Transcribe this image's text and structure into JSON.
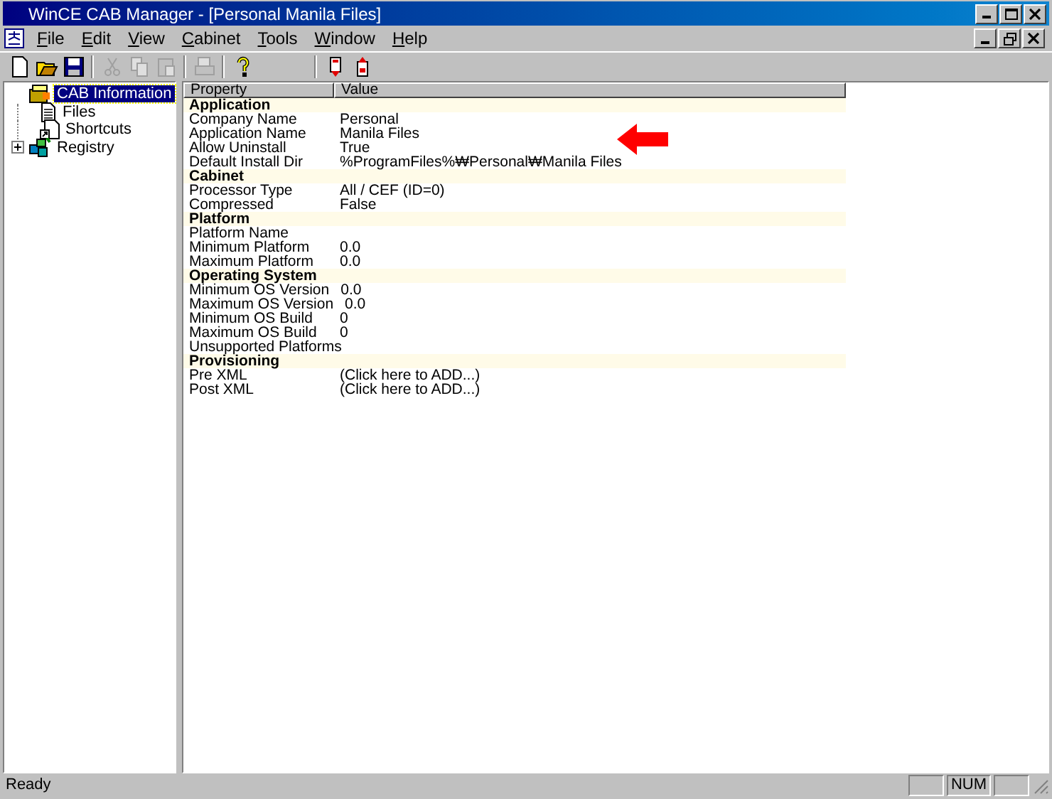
{
  "window": {
    "title": "WinCE CAB Manager - [Personal Manila Files]"
  },
  "menu": [
    "File",
    "Edit",
    "View",
    "Cabinet",
    "Tools",
    "Window",
    "Help"
  ],
  "toolbar": [
    {
      "kind": "new",
      "disabled": false
    },
    {
      "kind": "open",
      "disabled": false
    },
    {
      "kind": "save",
      "disabled": false
    },
    {
      "kind": "sep"
    },
    {
      "kind": "cut",
      "disabled": true
    },
    {
      "kind": "copy",
      "disabled": true
    },
    {
      "kind": "paste",
      "disabled": true
    },
    {
      "kind": "sep"
    },
    {
      "kind": "print",
      "disabled": true
    },
    {
      "kind": "sep"
    },
    {
      "kind": "help",
      "disabled": false
    },
    {
      "kind": "gap"
    },
    {
      "kind": "sep"
    },
    {
      "kind": "down",
      "disabled": false
    },
    {
      "kind": "up",
      "disabled": false
    }
  ],
  "tree": [
    {
      "label": "CAB Information",
      "kind": "cab",
      "selected": true,
      "expanded": true,
      "children": [
        {
          "label": "Files",
          "kind": "file",
          "selected": false
        },
        {
          "label": "Shortcuts",
          "kind": "shortcut",
          "selected": false
        }
      ]
    },
    {
      "label": "Registry",
      "kind": "registry",
      "selected": false,
      "expanded": false
    }
  ],
  "table": {
    "columns": [
      "Property",
      "Value"
    ],
    "rows": [
      {
        "kind": "section",
        "property": "Application"
      },
      {
        "kind": "item",
        "property": "Company Name",
        "value": "Personal"
      },
      {
        "kind": "item",
        "property": "Application Name",
        "value": "Manila Files"
      },
      {
        "kind": "item",
        "property": "Allow Uninstall",
        "value": "True"
      },
      {
        "kind": "item",
        "property": "Default Install Dir",
        "value": "%ProgramFiles%₩Personal₩Manila Files"
      },
      {
        "kind": "section",
        "property": "Cabinet"
      },
      {
        "kind": "item",
        "property": "Processor Type",
        "value": "All / CEF (ID=0)"
      },
      {
        "kind": "item",
        "property": "Compressed",
        "value": "False"
      },
      {
        "kind": "section",
        "property": "Platform"
      },
      {
        "kind": "item",
        "property": "Platform Name"
      },
      {
        "kind": "item",
        "property": "Minimum Platform",
        "value": "0.0"
      },
      {
        "kind": "item",
        "property": "Maximum Platform",
        "value": "0.0"
      },
      {
        "kind": "section",
        "property": "Operating System"
      },
      {
        "kind": "item",
        "property": "Minimum OS Version",
        "value": "0.0"
      },
      {
        "kind": "item",
        "property": "Maximum OS Version",
        "value": "0.0"
      },
      {
        "kind": "item",
        "property": "Minimum OS Build",
        "value": "0"
      },
      {
        "kind": "item",
        "property": "Maximum OS Build",
        "value": "0"
      },
      {
        "kind": "item",
        "property": "Unsupported Platforms"
      },
      {
        "kind": "section",
        "property": "Provisioning"
      },
      {
        "kind": "item",
        "property": "Pre XML",
        "value": "(Click here to ADD...)"
      },
      {
        "kind": "item",
        "property": "Post XML",
        "value": "(Click here to ADD...)"
      }
    ]
  },
  "status_bar": {
    "text": "Ready",
    "panes": [
      {
        "kind": "empty"
      },
      {
        "kind": "text",
        "text": "NUM"
      },
      {
        "kind": "empty"
      }
    ]
  }
}
